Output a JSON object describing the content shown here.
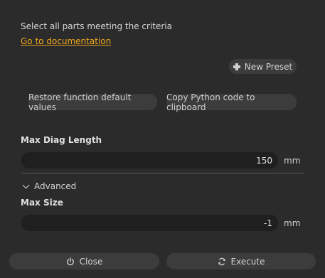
{
  "header": {
    "description": "Select all parts meeting the criteria",
    "doc_link": "Go to documentation"
  },
  "presets": {
    "new_preset_label": "New Preset"
  },
  "actions": {
    "restore_label": "Restore function default values",
    "copy_label": "Copy Python code to clipboard"
  },
  "fields": {
    "max_diag_length": {
      "label": "Max Diag Length",
      "value": "150",
      "unit": "mm"
    },
    "advanced_label": "Advanced",
    "max_size": {
      "label": "Max Size",
      "value": "-1",
      "unit": "mm"
    }
  },
  "footer": {
    "close_label": "Close",
    "execute_label": "Execute"
  },
  "colors": {
    "background": "#2b2b2b",
    "link": "#f0a81e",
    "button": "#3c3c3c",
    "input": "#1f1f1f"
  },
  "icons": [
    "plus-icon",
    "chevron-down-icon",
    "power-icon",
    "refresh-icon"
  ]
}
